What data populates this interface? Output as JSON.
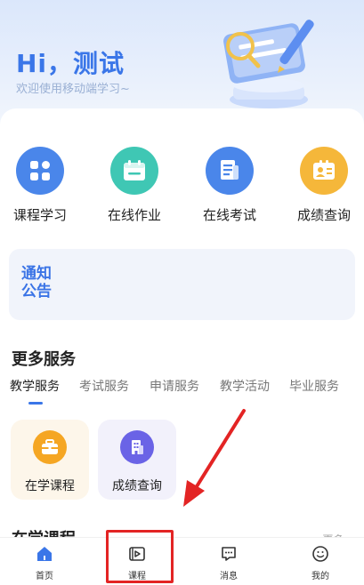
{
  "header": {
    "title": "Hi，测试",
    "subtitle": "欢迎使用移动端学习~"
  },
  "quick_actions": [
    {
      "label": "课程学习",
      "icon": "grid-icon",
      "color": "#4a86ea"
    },
    {
      "label": "在线作业",
      "icon": "calendar-icon",
      "color": "#3fc7b4"
    },
    {
      "label": "在线考试",
      "icon": "document-icon",
      "color": "#4a86ea"
    },
    {
      "label": "成绩查询",
      "icon": "id-card-icon",
      "color": "#f5b73a"
    }
  ],
  "notice": {
    "line1": "通知",
    "line2": "公告"
  },
  "more_services": {
    "title": "更多服务",
    "tabs": [
      "教学服务",
      "考试服务",
      "申请服务",
      "教学活动",
      "毕业服务"
    ],
    "active_tab": "教学服务",
    "cards": [
      {
        "label": "在学课程",
        "icon": "briefcase-icon",
        "color": "#f5a623",
        "bg": "#fdf6ea"
      },
      {
        "label": "成绩查询",
        "icon": "building-icon",
        "color": "#6a63e6",
        "bg": "#f2f1fb"
      }
    ]
  },
  "section": {
    "title": "在学课程",
    "more": "更多 ›"
  },
  "tabbar": [
    {
      "label": "首页",
      "icon": "home-icon",
      "active": true
    },
    {
      "label": "课程",
      "icon": "play-icon",
      "active": false
    },
    {
      "label": "消息",
      "icon": "message-icon",
      "active": false
    },
    {
      "label": "我的",
      "icon": "smile-icon",
      "active": false
    }
  ],
  "colors": {
    "primary": "#3a76e8",
    "highlight": "#e32424"
  }
}
